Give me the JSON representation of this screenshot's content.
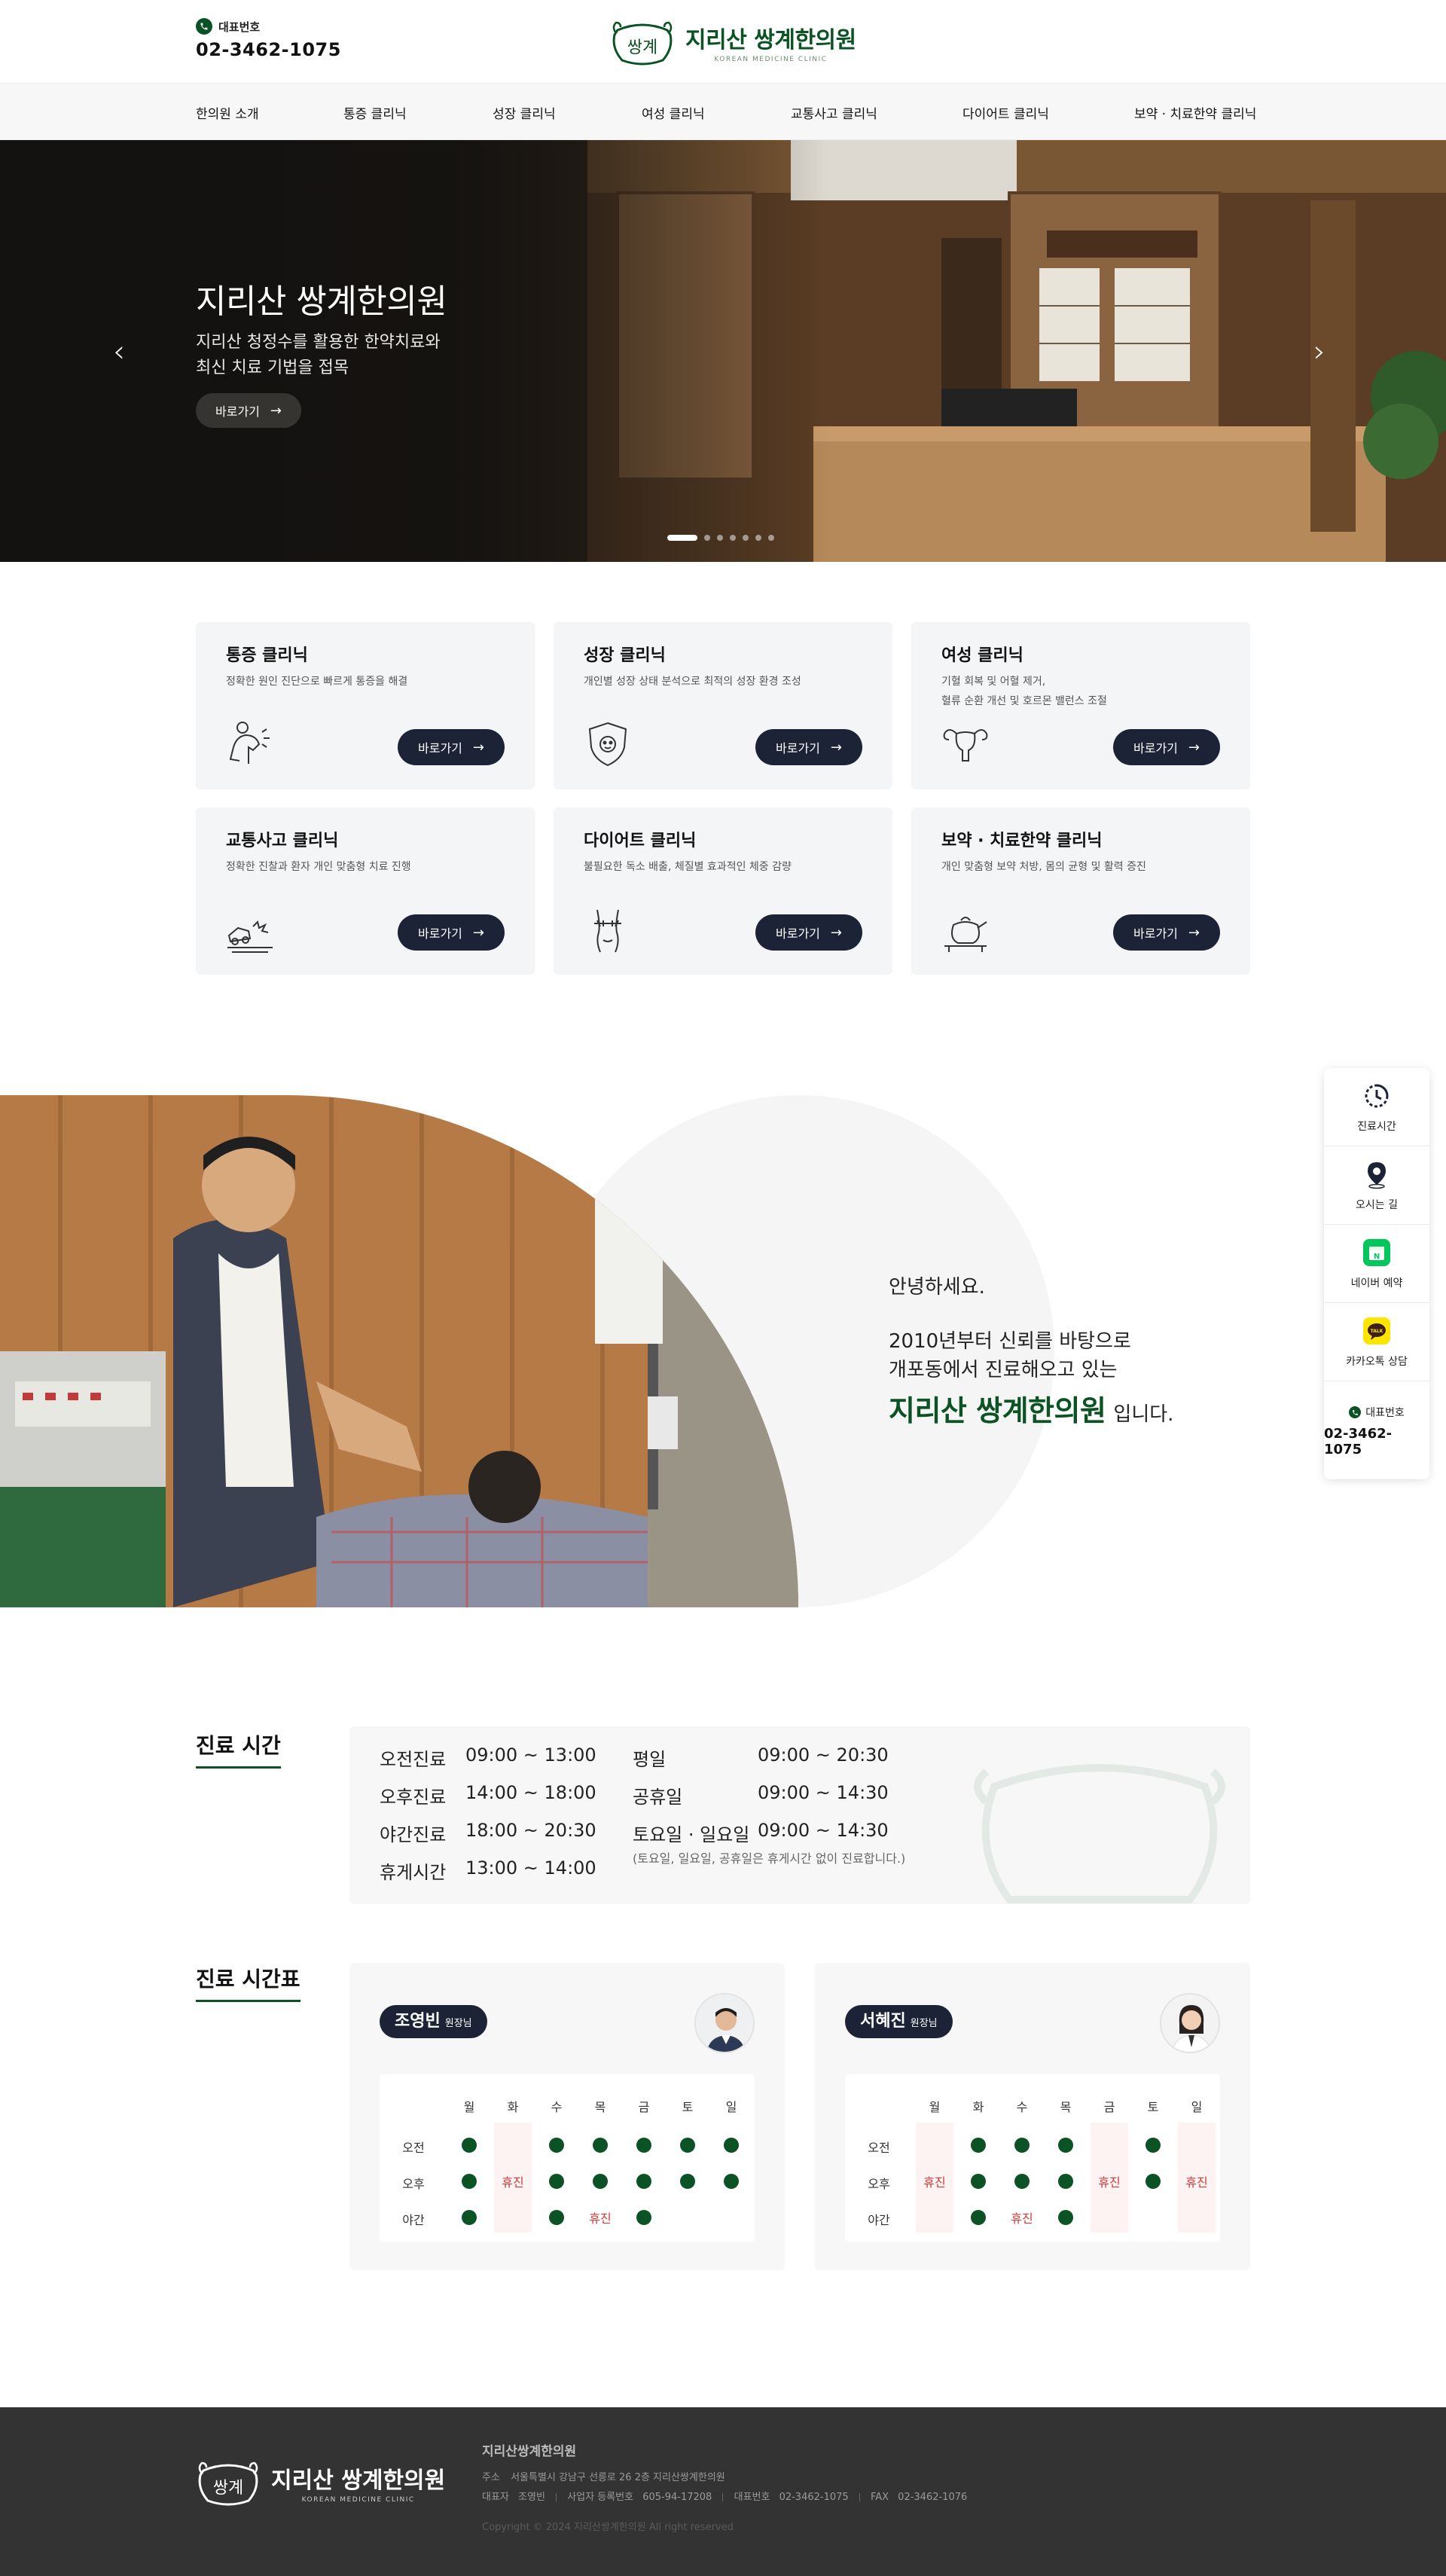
{
  "header": {
    "phone_label": "대표번호",
    "phone_number": "02-3462-1075",
    "logo_name": "지리산 쌍계한의원",
    "logo_sub": "KOREAN MEDICINE CLINIC",
    "logo_mark": "쌍계",
    "brand_color": "#0b5324"
  },
  "nav": {
    "items": [
      {
        "label": "한의원 소개"
      },
      {
        "label": "통증 클리닉"
      },
      {
        "label": "성장 클리닉"
      },
      {
        "label": "여성 클리닉"
      },
      {
        "label": "교통사고 클리닉"
      },
      {
        "label": "다이어트 클리닉"
      },
      {
        "label": "보약 · 치료한약 클리닉"
      }
    ]
  },
  "hero": {
    "title": "지리산 쌍계한의원",
    "desc_line1": "지리산 청정수를 활용한 한약치료와",
    "desc_line2": "최신 치료 기법을 접목",
    "button": "바로가기",
    "prev": "‹",
    "next": "›",
    "slide_count": 7,
    "active_slide": 1
  },
  "clinics": [
    {
      "title": "통증 클리닉",
      "desc": "정확한 원인 진단으로 빠르게 통증을 해결",
      "desc2": "",
      "button": "바로가기",
      "icon": "pain-icon"
    },
    {
      "title": "성장 클리닉",
      "desc": "개인별 성장 상태 분석으로 최적의 성장 환경 조성",
      "desc2": "",
      "button": "바로가기",
      "icon": "growth-icon"
    },
    {
      "title": "여성 클리닉",
      "desc": "기혈 회복 및 어혈 제거,",
      "desc2": "혈류 순환 개선 및 호르몬 밸런스 조절",
      "button": "바로가기",
      "icon": "uterus-icon"
    },
    {
      "title": "교통사고 클리닉",
      "desc": "정확한 진찰과 환자 개인 맞춤형 치료 진행",
      "desc2": "",
      "button": "바로가기",
      "icon": "car-crash-icon"
    },
    {
      "title": "다이어트 클리닉",
      "desc": "불필요한 독소 배출, 체질별 효과적인 체중 감량",
      "desc2": "",
      "button": "바로가기",
      "icon": "waist-icon"
    },
    {
      "title": "보약 · 치료한약 클리닉",
      "desc": "개인 맞춤형 보약 처방, 몸의 균형 및 활력 증진",
      "desc2": "",
      "button": "바로가기",
      "icon": "herbal-pot-icon"
    }
  ],
  "about": {
    "hello": "안녕하세요.",
    "line1": "2010년부터 신뢰를 바탕으로",
    "line2": "개포동에서 진료해오고 있는",
    "name": "지리산 쌍계한의원",
    "suffix": "입니다."
  },
  "quick_menu": {
    "items": [
      {
        "label": "진료시간",
        "icon": "clock-icon"
      },
      {
        "label": "오시는 길",
        "icon": "map-pin-icon"
      },
      {
        "label": "네이버 예약",
        "icon": "naver-booking-icon"
      },
      {
        "label": "카카오톡 상담",
        "icon": "kakaotalk-icon"
      }
    ],
    "kakao_badge": "TALK",
    "phone_label": "대표번호",
    "phone_number": "02-3462-1075"
  },
  "hours": {
    "title": "진료 시간",
    "left": [
      {
        "label": "오전진료",
        "time": "09:00 ~ 13:00"
      },
      {
        "label": "오후진료",
        "time": "14:00 ~ 18:00"
      },
      {
        "label": "야간진료",
        "time": "18:00 ~ 20:30"
      },
      {
        "label": "휴게시간",
        "time": "13:00 ~ 14:00"
      }
    ],
    "right": [
      {
        "label": "평일",
        "time": "09:00 ~ 20:30"
      },
      {
        "label": "공휴일",
        "time": "09:00 ~ 14:30"
      },
      {
        "label": "토요일 · 일요일",
        "time": "09:00 ~ 14:30"
      }
    ],
    "note": "(토요일, 일요일, 공휴일은 휴게시간 없이 진료합니다.)"
  },
  "schedule": {
    "title": "진료 시간표",
    "days": [
      "월",
      "화",
      "수",
      "목",
      "금",
      "토",
      "일"
    ],
    "rows": [
      "오전",
      "오후",
      "야간"
    ],
    "off_label": "휴진",
    "doctors": [
      {
        "name": "조영빈",
        "role": "원장님",
        "off_cols": [
          1
        ],
        "cells": [
          [
            "on",
            "",
            "on",
            "on",
            "on",
            "on",
            "on"
          ],
          [
            "on",
            "off",
            "on",
            "on",
            "on",
            "on",
            "on"
          ],
          [
            "on",
            "",
            "on",
            "off",
            "on",
            "",
            ""
          ]
        ]
      },
      {
        "name": "서혜진",
        "role": "원장님",
        "off_cols": [
          0,
          4,
          6
        ],
        "cells": [
          [
            "",
            "on",
            "on",
            "on",
            "",
            "on",
            ""
          ],
          [
            "off",
            "on",
            "on",
            "on",
            "off",
            "on",
            "off"
          ],
          [
            "",
            "on",
            "off",
            "on",
            "",
            "",
            ""
          ]
        ]
      }
    ]
  },
  "footer": {
    "name": "지리산쌍계한의원",
    "address_label": "주소",
    "address": "서울특별시 강남구 선릉로 26 2층 지리산쌍계한의원",
    "ceo_label": "대표자",
    "ceo": "조영빈",
    "biz_label": "사업자 등록번호",
    "biz": "605-94-17208",
    "tel_label": "대표번호",
    "tel": "02-3462-1075",
    "fax_label": "FAX",
    "fax": "02-3462-1076",
    "copyright": "Copyright © 2024 지리산쌍계한의원 All right reserved"
  }
}
